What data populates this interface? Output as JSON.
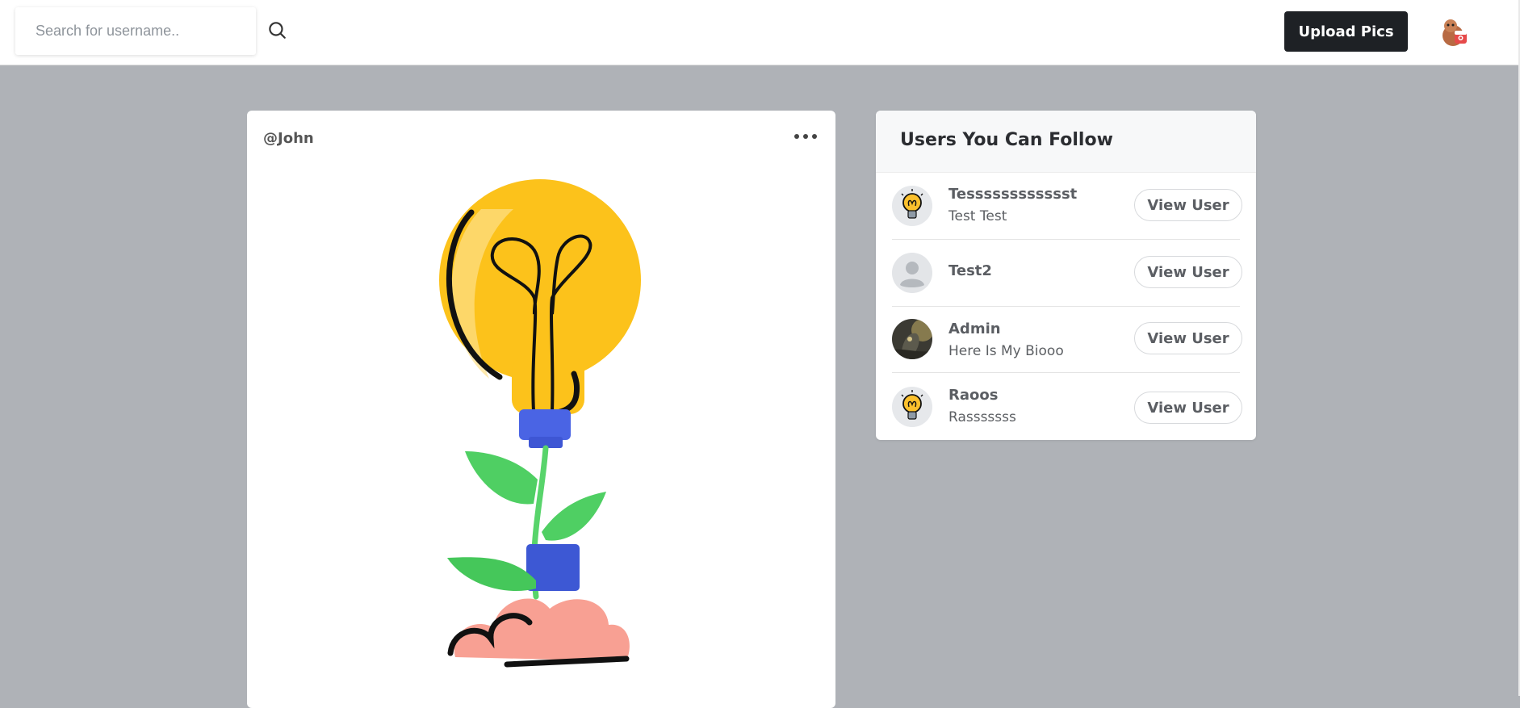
{
  "navbar": {
    "search": {
      "placeholder": "Search for username..",
      "value": ""
    },
    "search_icon": "search-icon",
    "upload_label": "Upload Pics",
    "profile_icon": "user-avatar-icon",
    "colors": {
      "upload_bg": "#1e2125",
      "page_bg": "#afb2b7"
    }
  },
  "post": {
    "username": "@John",
    "menu_icon": "more-horizontal-icon",
    "image_icon": "lightbulb-plant-illustration"
  },
  "follow": {
    "title": "Users You Can Follow",
    "users": [
      {
        "name": "Tesssssssssssst",
        "bio": "Test Test",
        "button": "View User",
        "avatar": "lightbulb-avatar-icon"
      },
      {
        "name": "Test2",
        "bio": "",
        "button": "View User",
        "avatar": "default-person-avatar-icon"
      },
      {
        "name": "Admin",
        "bio": "Here Is My Biooo",
        "button": "View User",
        "avatar": "photo-avatar"
      },
      {
        "name": "Raoos",
        "bio": "Rasssssss",
        "button": "View User",
        "avatar": "lightbulb-avatar-icon"
      }
    ]
  }
}
